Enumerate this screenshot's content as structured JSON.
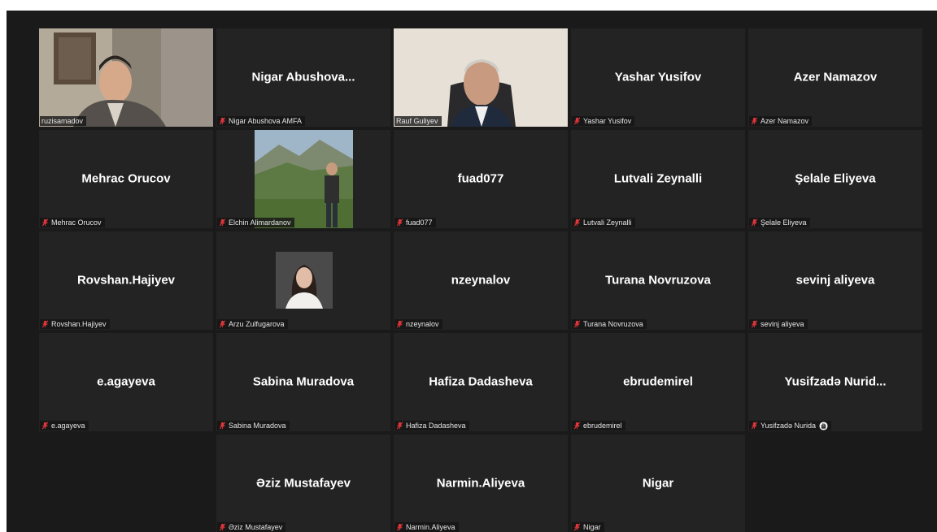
{
  "meeting": {
    "grid_columns": 5,
    "tiles": [
      {
        "key": "ruzisamadov",
        "display": "",
        "label": "ruzisamadov",
        "muted": false,
        "video": "portrait-man",
        "active": false
      },
      {
        "key": "nigar-abushova",
        "display": "Nigar  Abushova...",
        "label": "Nigar Abushova AMFA",
        "muted": true,
        "video": null,
        "active": false
      },
      {
        "key": "rauf-guliyev",
        "display": "",
        "label": "Rauf Guliyev",
        "muted": false,
        "video": "portrait-man-office",
        "active": true
      },
      {
        "key": "yashar-yusifov",
        "display": "Yashar Yusifov",
        "label": "Yashar Yusifov",
        "muted": true,
        "video": null,
        "active": false
      },
      {
        "key": "azer-namazov",
        "display": "Azer Namazov",
        "label": "Azer Namazov",
        "muted": true,
        "video": null,
        "active": false
      },
      {
        "key": "mehrac-orucov",
        "display": "Mehrac Orucov",
        "label": "Mehrac Orucov",
        "muted": true,
        "video": null,
        "active": false
      },
      {
        "key": "elchin-alimardanov",
        "display": "",
        "label": "Elchin Alimardanov",
        "muted": true,
        "video": "landscape-photo",
        "active": false
      },
      {
        "key": "fuad077",
        "display": "fuad077",
        "label": "fuad077",
        "muted": true,
        "video": null,
        "active": false
      },
      {
        "key": "lutvali-zeynalli",
        "display": "Lutvali Zeynalli",
        "label": "Lutvali Zeynalli",
        "muted": true,
        "video": null,
        "active": false
      },
      {
        "key": "selale-eliyeva",
        "display": "Şelale Eliyeva",
        "label": "Şelale Eliyeva",
        "muted": true,
        "video": null,
        "active": false
      },
      {
        "key": "rovshan-hajiyev",
        "display": "Rovshan.Hajiyev",
        "label": "Rovshan.Hajiyev",
        "muted": true,
        "video": null,
        "active": false
      },
      {
        "key": "arzu-zulfugarova",
        "display": "",
        "label": "Arzu Zulfugarova",
        "muted": true,
        "video": "profile-photo-woman",
        "active": false
      },
      {
        "key": "nzeynalov",
        "display": "nzeynalov",
        "label": "nzeynalov",
        "muted": true,
        "video": null,
        "active": false
      },
      {
        "key": "turana-novruzova",
        "display": "Turana Novruzova",
        "label": "Turana Novruzova",
        "muted": true,
        "video": null,
        "active": false
      },
      {
        "key": "sevinj-aliyeva",
        "display": "sevinj aliyeva",
        "label": "sevinj aliyeva",
        "muted": true,
        "video": null,
        "active": false
      },
      {
        "key": "e-agayeva",
        "display": "e.agayeva",
        "label": "e.agayeva",
        "muted": true,
        "video": null,
        "active": false
      },
      {
        "key": "sabina-muradova",
        "display": "Sabina Muradova",
        "label": "Sabina Muradova",
        "muted": true,
        "video": null,
        "active": false
      },
      {
        "key": "hafiza-dadasheva",
        "display": "Hafiza Dadasheva",
        "label": "Hafiza Dadasheva",
        "muted": true,
        "video": null,
        "active": false
      },
      {
        "key": "ebrudemirel",
        "display": "ebrudemirel",
        "label": "ebrudemirel",
        "muted": true,
        "video": null,
        "active": false
      },
      {
        "key": "yusifzade-nurida",
        "display": "Yusifzadə  Nurid...",
        "label": "Yusifzadə Nurida",
        "muted": true,
        "video": null,
        "active": false,
        "raised_hand": true
      },
      {
        "key": "empty-slot",
        "empty": true
      },
      {
        "key": "eziz-mustafayev",
        "display": "Əziz Mustafayev",
        "label": "Əziz Mustafayev",
        "muted": true,
        "video": null,
        "active": false
      },
      {
        "key": "narmin-aliyeva",
        "display": "Narmin.Aliyeva",
        "label": "Narmin.Aliyeva",
        "muted": true,
        "video": null,
        "active": false
      },
      {
        "key": "nigar",
        "display": "Nigar",
        "label": "Nigar",
        "muted": true,
        "video": null,
        "active": false
      }
    ]
  },
  "colors": {
    "background": "#1a1a1a",
    "tile": "#232323",
    "active_speaker_border": "#d8e24a",
    "muted_icon": "#e0363a"
  }
}
